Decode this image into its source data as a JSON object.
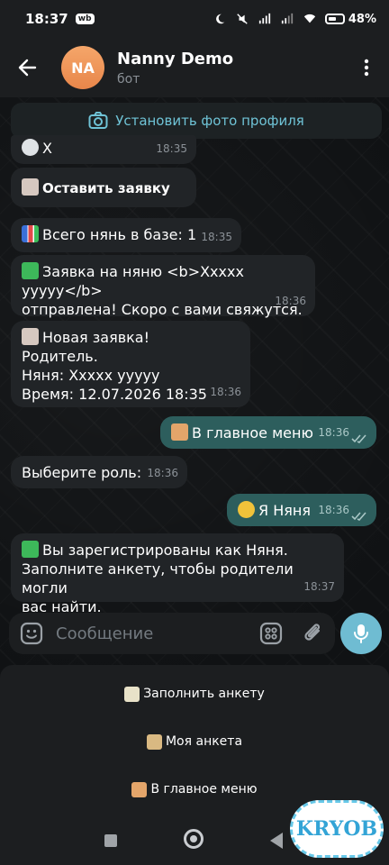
{
  "status_bar": {
    "time": "18:37",
    "badge": "wb",
    "battery_percent": "48%"
  },
  "header": {
    "avatar_initials": "NA",
    "title": "Nanny Demo",
    "subtitle": "бот"
  },
  "set_photo": {
    "label": "Установить фото профиля"
  },
  "messages": [
    {
      "text": "X",
      "time": "18:35"
    },
    {
      "text": "Оставить заявку"
    },
    {
      "text": "Всего нянь в базе: 1",
      "time": "18:35"
    },
    {
      "line1": "Заявка на няню <b>Xxxxx yyyyy</b>",
      "line2": "отправлена! Скоро с вами свяжутся.",
      "time": "18:36"
    },
    {
      "line1": "Новая заявка!",
      "line2": "Родитель.",
      "line3": "Няня: Xxxxx yyyyy",
      "line4": "Время: 12.07.2026 18:35",
      "time": "18:36"
    },
    {
      "text": "В главное меню",
      "time": "18:36",
      "outgoing": true
    },
    {
      "text": "Выберите роль:",
      "time": "18:36"
    },
    {
      "text": "Я Няня",
      "time": "18:36",
      "outgoing": true
    },
    {
      "line1": "Вы зарегистрированы как Няня.",
      "line2": "Заполните анкету, чтобы родители могли",
      "line3": "вас найти.",
      "time": "18:37"
    }
  ],
  "composer": {
    "placeholder": "Сообщение"
  },
  "keyboard": {
    "buttons": [
      "Заполнить анкету",
      "Моя анкета",
      "В главное меню"
    ]
  },
  "watermark": {
    "text": "KRYOB"
  },
  "colors": {
    "accent": "#6fbcd2",
    "outgoing_bubble": "#2d5e5d",
    "incoming_bubble": "#212427",
    "avatar": "#e8864a"
  }
}
